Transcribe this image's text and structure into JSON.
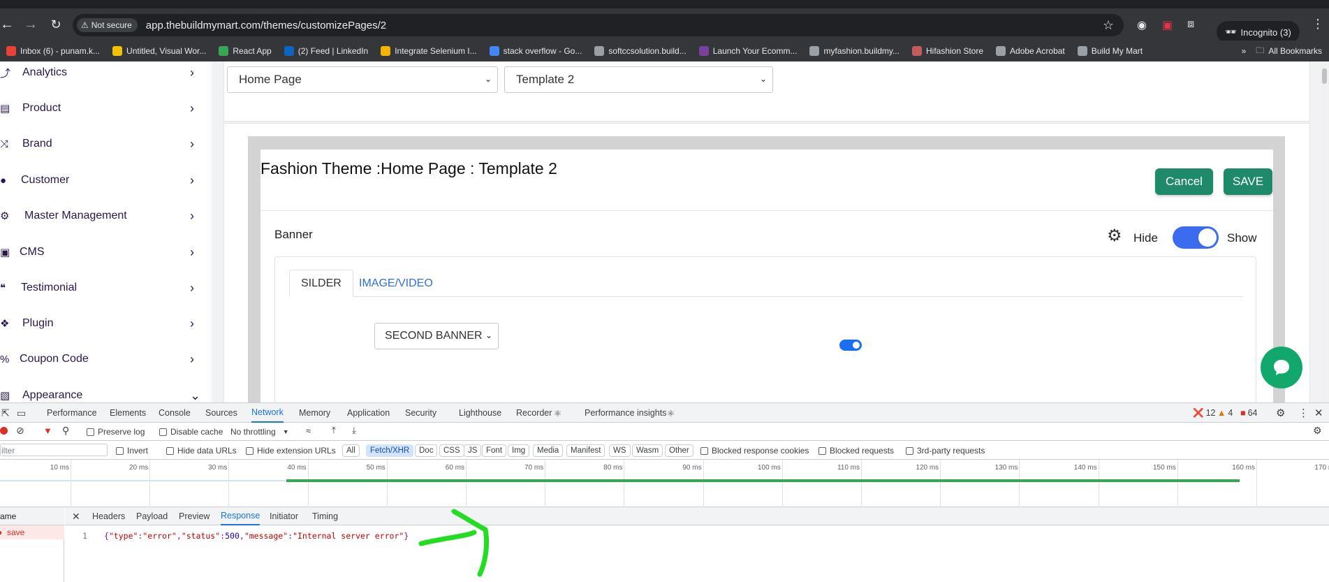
{
  "browser": {
    "security_label": "Not secure",
    "url": "app.thebuildmymart.com/themes/customizePages/2",
    "incognito_label": "Incognito (3)"
  },
  "bookmarks": {
    "items": [
      {
        "label": "Inbox (6) - punam.k...",
        "icon": "gmail-icon",
        "color": "#ea4335"
      },
      {
        "label": "Untitled, Visual Wor...",
        "icon": "miro-icon",
        "color": "#f2c200"
      },
      {
        "label": "React App",
        "icon": "leaf-icon",
        "color": "#34a853"
      },
      {
        "label": "(2) Feed | LinkedIn",
        "icon": "linkedin-icon",
        "color": "#0a66c2"
      },
      {
        "label": "Integrate Selenium I...",
        "icon": "chrome-icon",
        "color": "#f4b400"
      },
      {
        "label": "stack overflow - Go...",
        "icon": "google-icon",
        "color": "#4285f4"
      },
      {
        "label": "softccsolution.build...",
        "icon": "globe-icon",
        "color": "#9aa0a6"
      },
      {
        "label": "Launch Your Ecomm...",
        "icon": "store-icon",
        "color": "#7b3fa0"
      },
      {
        "label": "myfashion.buildmy...",
        "icon": "globe-icon",
        "color": "#9aa0a6"
      },
      {
        "label": "Hifashion Store",
        "icon": "person-icon",
        "color": "#c25b5b"
      },
      {
        "label": "Adobe Acrobat",
        "icon": "globe-icon",
        "color": "#9aa0a6"
      },
      {
        "label": "Build My Mart",
        "icon": "globe-icon",
        "color": "#9aa0a6"
      }
    ],
    "more": "»",
    "all_bookmarks": "All Bookmarks"
  },
  "sidebar": {
    "items": [
      {
        "label": "Analytics",
        "icon": "chart-icon"
      },
      {
        "label": "Product",
        "icon": "box-icon"
      },
      {
        "label": "Brand",
        "icon": "shuffle-icon"
      },
      {
        "label": "Customer",
        "icon": "user-icon"
      },
      {
        "label": "Master Management",
        "icon": "users-cog-icon"
      },
      {
        "label": "CMS",
        "icon": "folder-icon"
      },
      {
        "label": "Testimonial",
        "icon": "quote-icon"
      },
      {
        "label": "Plugin",
        "icon": "puzzle-icon"
      },
      {
        "label": "Coupon Code",
        "icon": "percent-icon"
      },
      {
        "label": "Appearance",
        "icon": "paint-icon"
      }
    ]
  },
  "page_select": {
    "value": "Home Page"
  },
  "template_select": {
    "value": "Template 2"
  },
  "editor": {
    "title": "Fashion Theme :Home Page : Template 2",
    "cancel": "Cancel",
    "save": "SAVE",
    "cancel_color": "#1f8a6a",
    "save_color": "#1f8a6a",
    "section": "Banner",
    "hide": "Hide",
    "show": "Show",
    "show_toggle_on": true,
    "tabs": [
      "SILDER",
      "IMAGE/VIDEO"
    ],
    "banner_select": "SECOND BANNER"
  },
  "devtools": {
    "tabs": [
      "Performance",
      "Elements",
      "Console",
      "Sources",
      "Network",
      "Memory",
      "Application",
      "Security",
      "Lighthouse",
      "Recorder",
      "Performance insights"
    ],
    "active_tab": "Network",
    "errors": "12",
    "warnings": "4",
    "messages": "64",
    "toolbar": {
      "preserve_log": "Preserve log",
      "disable_cache": "Disable cache",
      "throttling": "No throttling"
    },
    "filter": {
      "placeholder": "ilter",
      "invert": "Invert",
      "hide_data_urls": "Hide data URLs",
      "hide_ext_urls": "Hide extension URLs",
      "types": [
        "All",
        "Fetch/XHR",
        "Doc",
        "CSS",
        "JS",
        "Font",
        "Img",
        "Media",
        "Manifest",
        "WS",
        "Wasm",
        "Other"
      ],
      "active_type": "Fetch/XHR",
      "blocked_cookies": "Blocked response cookies",
      "blocked_requests": "Blocked requests",
      "third_party": "3rd-party requests"
    },
    "timeline": {
      "ticks": [
        "10 ms",
        "20 ms",
        "30 ms",
        "40 ms",
        "50 ms",
        "60 ms",
        "70 ms",
        "80 ms",
        "90 ms",
        "100 ms",
        "110 ms",
        "120 ms",
        "130 ms",
        "140 ms",
        "150 ms",
        "160 ms",
        "170 m"
      ]
    },
    "request_list": {
      "header": "ame",
      "rows": [
        "save"
      ]
    },
    "detail_tabs": [
      "Headers",
      "Payload",
      "Preview",
      "Response",
      "Initiator",
      "Timing"
    ],
    "active_detail_tab": "Response",
    "response": {
      "line_number": "1",
      "open": "{",
      "k1": "\"type\"",
      "v1": "\"error\"",
      "k2": "\"status\"",
      "v2": "500",
      "k3": "\"message\"",
      "v3": "\"Internal server error\"",
      "close": "}"
    }
  }
}
